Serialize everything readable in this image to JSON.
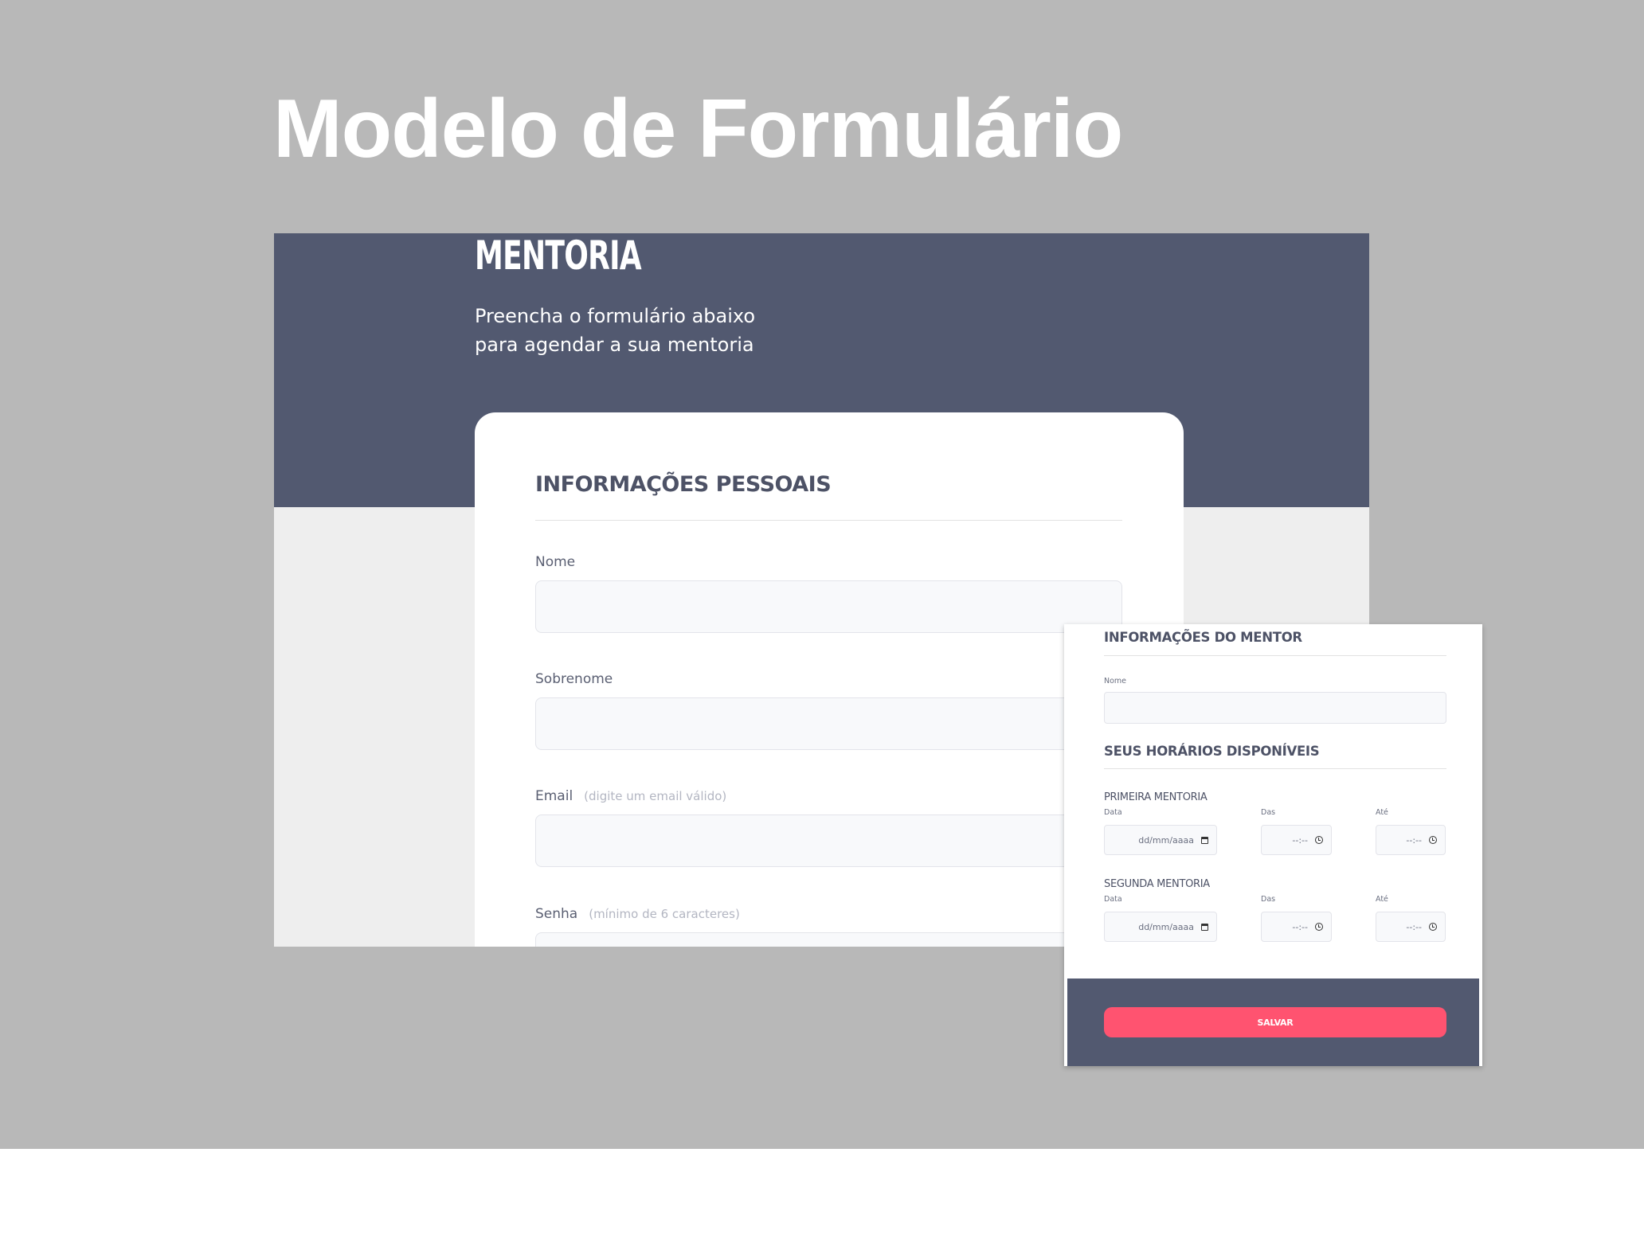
{
  "page": {
    "title": "Modelo de Formulário",
    "colors": {
      "backdrop": "#b8b8b8",
      "hero": "#525970",
      "accent": "#ff5370",
      "text_heading": "#4d5266"
    }
  },
  "hero": {
    "brand": "MENTORIA",
    "subtitle_line1": "Preencha o formulário abaixo",
    "subtitle_line2": "para agendar a sua mentoria"
  },
  "personal_info": {
    "title": "INFORMAÇÕES PESSOAIS",
    "fields": [
      {
        "label": "Nome",
        "hint": "",
        "value": ""
      },
      {
        "label": "Sobrenome",
        "hint": "",
        "value": ""
      },
      {
        "label": "Email",
        "hint": "(digite um email válido)",
        "value": ""
      },
      {
        "label": "Senha",
        "hint": "(mínimo de 6 caracteres)",
        "value": ""
      }
    ]
  },
  "mentor_panel": {
    "mentor_title": "INFORMAÇÕES DO MENTOR",
    "mentor_name_label": "Nome",
    "schedule_title": "SEUS HORÁRIOS DISPONÍVEIS",
    "sessions": [
      {
        "title": "PRIMEIRA MENTORIA",
        "date_label": "Data",
        "date_placeholder": "dd/mm/aaaa",
        "date_icon": "calendar-icon",
        "from_label": "Das",
        "from_placeholder": "--:--",
        "from_icon": "clock-icon",
        "to_label": "Até",
        "to_placeholder": "--:--",
        "to_icon": "clock-icon"
      },
      {
        "title": "SEGUNDA MENTORIA",
        "date_label": "Data",
        "date_placeholder": "dd/mm/aaaa",
        "date_icon": "calendar-icon",
        "from_label": "Das",
        "from_placeholder": "--:--",
        "from_icon": "clock-icon",
        "to_label": "Até",
        "to_placeholder": "--:--",
        "to_icon": "clock-icon"
      }
    ],
    "save_label": "SALVAR"
  }
}
